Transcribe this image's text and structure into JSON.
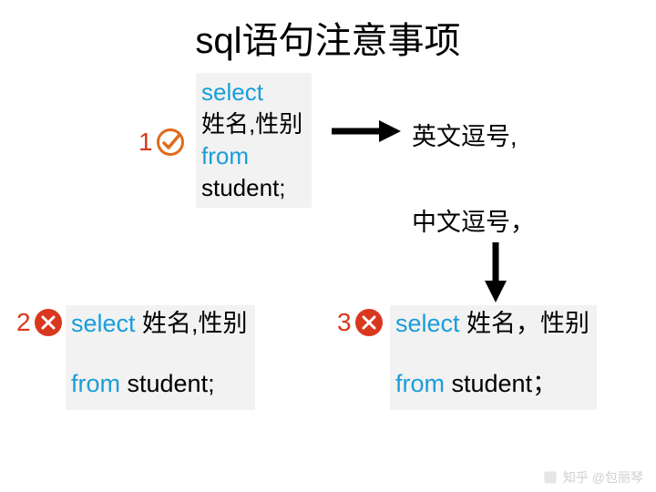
{
  "title": "sql语句注意事项",
  "markers": {
    "m1": "1",
    "m2": "2",
    "m3": "3"
  },
  "box1": {
    "l1": "select",
    "l2": "姓名,性别",
    "l3": "from",
    "l4": "student;"
  },
  "box2": {
    "kw1": "select",
    "cols": " 姓名,性别",
    "kw2": "from",
    "tbl": " student;"
  },
  "box3": {
    "kw1": "select",
    "cols": " 姓名，性别",
    "kw2": "from",
    "tbl": " student；"
  },
  "annotations": {
    "english_comma": "英文逗号,",
    "chinese_comma": "中文逗号，"
  },
  "watermark": "知乎 @包丽琴"
}
